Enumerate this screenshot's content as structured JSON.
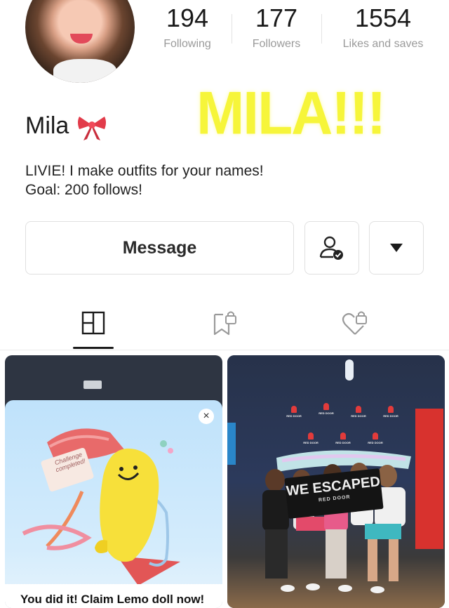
{
  "profile": {
    "name": "Mila",
    "overlay_text": "MILA!!!",
    "bio_line1": "LIVIE! I make outfits for your names!",
    "bio_line2": "Goal: 200 follows!"
  },
  "stats": {
    "following": {
      "value": "194",
      "label": "Following"
    },
    "followers": {
      "value": "177",
      "label": "Followers"
    },
    "likes": {
      "value": "1554",
      "label": "Likes and saves"
    }
  },
  "actions": {
    "message_label": "Message"
  },
  "tabs": [
    {
      "name": "grid",
      "icon": "grid-icon",
      "active": true
    },
    {
      "name": "saved",
      "icon": "bookmark-lock-icon",
      "active": false
    },
    {
      "name": "liked",
      "icon": "heart-lock-icon",
      "active": false
    }
  ],
  "posts": {
    "left": {
      "popup_stamp": "Challenge completed!",
      "popup_title": "You did it! Claim Lemo doll now!"
    },
    "right": {
      "sign_text": "WE ESCAPED",
      "sign_sub": "RED DOOR",
      "wall_logo": "RED DOOR"
    }
  },
  "colors": {
    "overlay_yellow": "#f6f53a",
    "popup_blue": "#bfe2fb",
    "lemon_yellow": "#f7e03a",
    "bow_red": "#e23b4a"
  }
}
